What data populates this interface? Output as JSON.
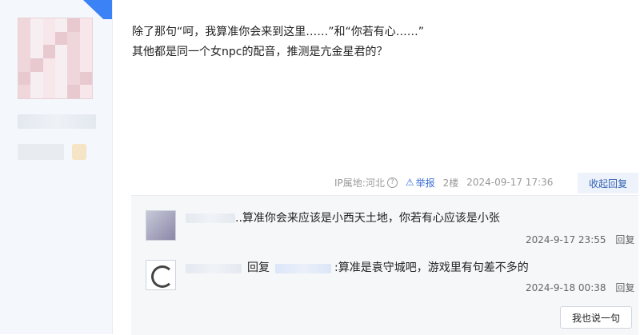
{
  "post": {
    "line1": "除了那句“呵，我算准你会来到这里……”和“你若有心……”",
    "line2": "其他都是同一个女npc的配音，推测是亢金星君的？"
  },
  "meta": {
    "ip_label": "IP属地:河北",
    "report_label": "举报",
    "floor": "2楼",
    "timestamp": "2024-09-17 17:36",
    "collapse_label": "收起回复"
  },
  "replies": [
    {
      "text": "..算准你会来应该是小西天土地，你若有心应该是小张",
      "time": "2024-9-17 23:55",
      "reply_label": "回复"
    },
    {
      "prefix": "回复",
      "text": ":算准是袁守城吧，游戏里有句差不多的",
      "time": "2024-9-18 00:38",
      "reply_label": "回复"
    }
  ],
  "say_button_label": "我也说一句",
  "colors": {
    "accent": "#3b6fd6",
    "sidebar_bg": "#f4f7fb",
    "reply_bg": "#f6f7f9"
  },
  "icons": {
    "help": "help-circle-icon",
    "report": "warning-triangle-icon"
  }
}
